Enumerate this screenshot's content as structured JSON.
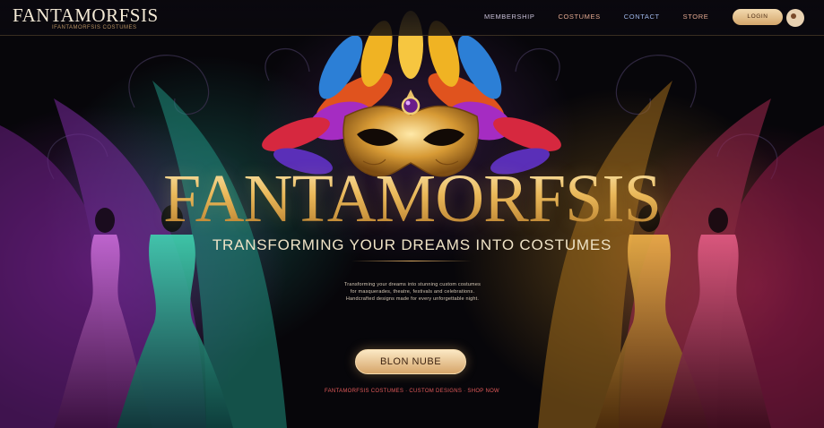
{
  "header": {
    "brand": "FANTAMORFSIS",
    "tagline": "IFANTAMORFSIS COSTUMES",
    "nav": [
      "MEMBERSHIP",
      "COSTUMES",
      "CONTACT",
      "STORE"
    ],
    "cta_label": "LOGIN"
  },
  "hero": {
    "title": "FANTAMORFSIS",
    "subtitle": "TRANSFORMING YOUR DREAMS INTO COSTUMES",
    "body_lines": [
      "Transforming your dreams into stunning custom costumes",
      "for masquerades, theatre, festivals and celebrations.",
      "Handcrafted designs made for every unforgettable night."
    ],
    "cta_label": "BLON NUBE"
  },
  "footer": {
    "note": "FANTAMORFSIS COSTUMES · CUSTOM DESIGNS · SHOP NOW"
  },
  "colors": {
    "gold": "#e8b85a",
    "background": "#07060a",
    "accent_red": "#e25a5a"
  }
}
